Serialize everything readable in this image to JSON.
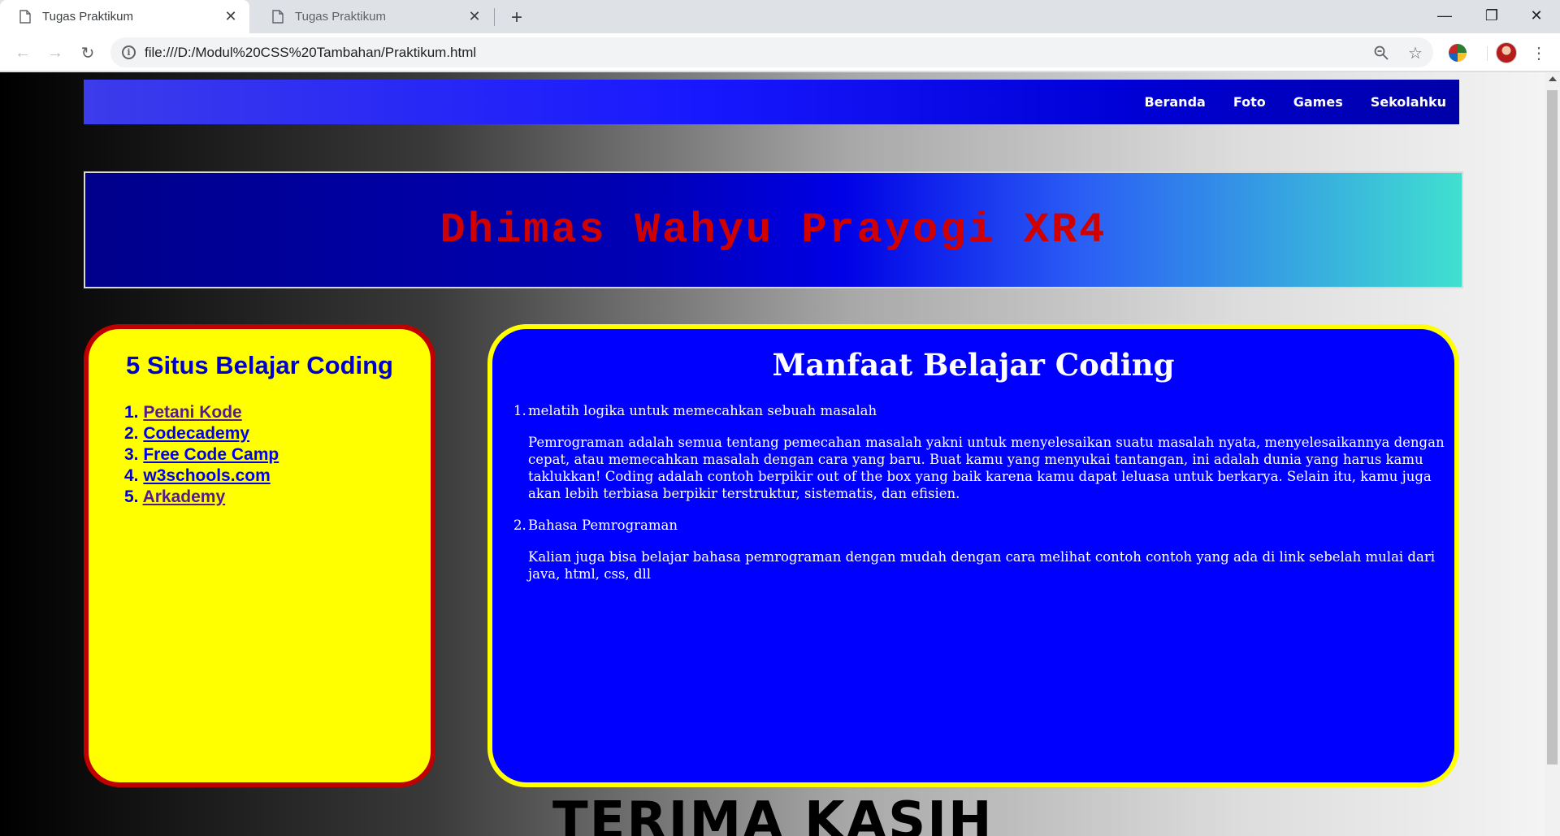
{
  "browser": {
    "tabs": [
      {
        "title": "Tugas Praktikum",
        "active": true
      },
      {
        "title": "Tugas Praktikum",
        "active": false
      }
    ],
    "new_tab_symbol": "+",
    "url": "file:///D:/Modul%20CSS%20Tambahan/Praktikum.html",
    "icons": [
      "back-icon",
      "forward-icon",
      "reload-icon",
      "info-icon",
      "zoom-icon",
      "bookmark-star-icon",
      "extension-icon",
      "profile-avatar",
      "menu-icon",
      "minimize-icon",
      "maximize-icon",
      "close-icon"
    ]
  },
  "page": {
    "nav": [
      "Beranda",
      "Foto",
      "Games",
      "Sekolahku"
    ],
    "banner_title": "Dhimas Wahyu Prayogi XR4",
    "left": {
      "title": "5 Situs Belajar Coding",
      "links": [
        {
          "num": "1.",
          "label": "Petani Kode"
        },
        {
          "num": "2.",
          "label": "Codecademy"
        },
        {
          "num": "3.",
          "label": "Free Code Camp"
        },
        {
          "num": "4.",
          "label": "w3schools.com"
        },
        {
          "num": "5.",
          "label": "Arkademy"
        }
      ]
    },
    "right": {
      "title": "Manfaat Belajar Coding",
      "items": [
        {
          "num": "1.",
          "heading": "melatih logika untuk memecahkan sebuah masalah",
          "body": "Pemrograman adalah semua tentang pemecahan masalah yakni untuk menyelesaikan suatu masalah nyata, menyelesaikannya dengan cepat, atau memecahkan masalah dengan cara yang baru. Buat kamu yang menyukai tantangan, ini adalah dunia yang harus kamu taklukkan! Coding adalah contoh berpikir out of the box yang baik karena kamu dapat leluasa untuk berkarya. Selain itu, kamu juga akan lebih terbiasa berpikir terstruktur, sistematis, dan efisien."
        },
        {
          "num": "2.",
          "heading": "Bahasa Pemrograman",
          "body": "Kalian juga bisa belajar bahasa pemrograman dengan mudah dengan cara melihat contoh contoh yang ada di link sebelah mulai dari java, html, css, dll"
        }
      ]
    },
    "footer": "TERIMA KASIH"
  },
  "colors": {
    "navbar": "#1818ff",
    "banner_text": "#d00000",
    "left_box_bg": "#ffff00",
    "left_box_border": "#c00000",
    "right_box_bg": "#0000ff",
    "right_box_border": "#ffff00"
  }
}
